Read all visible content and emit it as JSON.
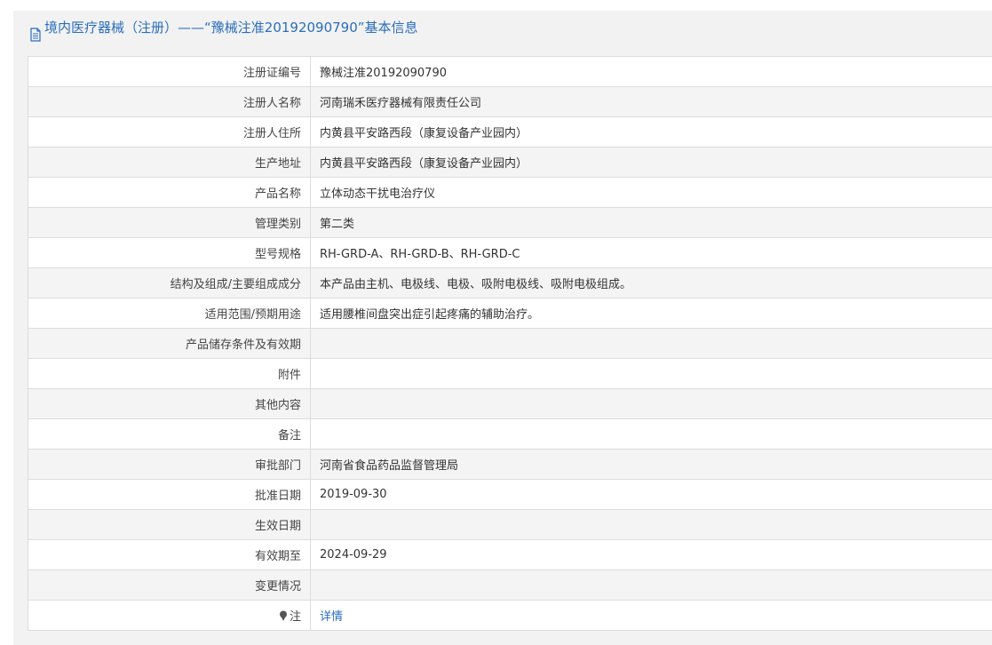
{
  "header": {
    "title": "境内医疗器械（注册）——“豫械注准20192090790”基本信息"
  },
  "rows": [
    {
      "label": "注册证编号",
      "value": "豫械注准20192090790"
    },
    {
      "label": "注册人名称",
      "value": "河南瑞禾医疗器械有限责任公司"
    },
    {
      "label": "注册人住所",
      "value": "内黄县平安路西段（康复设备产业园内）"
    },
    {
      "label": "生产地址",
      "value": "内黄县平安路西段（康复设备产业园内）"
    },
    {
      "label": "产品名称",
      "value": "立体动态干扰电治疗仪"
    },
    {
      "label": "管理类别",
      "value": "第二类"
    },
    {
      "label": "型号规格",
      "value": "RH-GRD-A、RH-GRD-B、RH-GRD-C"
    },
    {
      "label": "结构及组成/主要组成成分",
      "value": "本产品由主机、电极线、电极、吸附电极线、吸附电极组成。"
    },
    {
      "label": "适用范围/预期用途",
      "value": "适用腰椎间盘突出症引起疼痛的辅助治疗。"
    },
    {
      "label": "产品储存条件及有效期",
      "value": ""
    },
    {
      "label": "附件",
      "value": ""
    },
    {
      "label": "其他内容",
      "value": ""
    },
    {
      "label": "备注",
      "value": ""
    },
    {
      "label": "审批部门",
      "value": "河南省食品药品监督管理局"
    },
    {
      "label": "批准日期",
      "value": "2019-09-30"
    },
    {
      "label": "生效日期",
      "value": ""
    },
    {
      "label": "有效期至",
      "value": "2024-09-29"
    },
    {
      "label": "变更情况",
      "value": ""
    }
  ],
  "note_row": {
    "label": "注",
    "link_text": "详情"
  }
}
